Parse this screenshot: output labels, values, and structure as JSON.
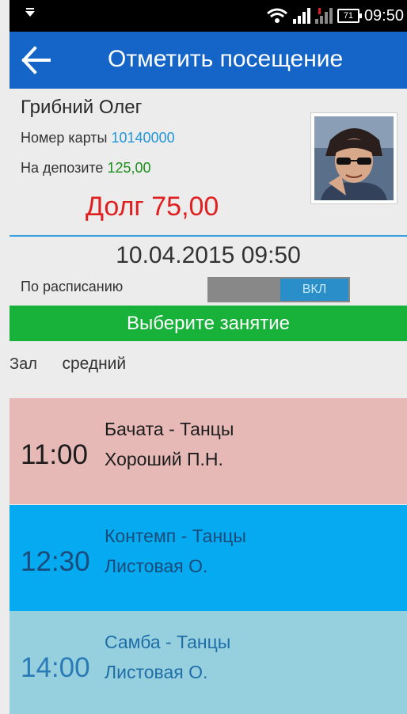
{
  "status_bar": {
    "battery": "71",
    "time": "09:50"
  },
  "app_bar": {
    "title": "Отметить посещение"
  },
  "client": {
    "name": "Грибний Олег",
    "card_label": "Номер карты",
    "card_number": "10140000",
    "deposit_label": "На депозите",
    "deposit_value": "125,00",
    "debt_text": "Долг 75,00"
  },
  "visit": {
    "datetime": "10.04.2015 09:50",
    "schedule_label": "По расписанию",
    "schedule_toggle": "ВКЛ",
    "choose_label": "Выберите занятие",
    "hall_label": "Зал",
    "hall_value": "средний"
  },
  "lessons": [
    {
      "time": "11:00",
      "title": "Бачата - Танцы",
      "teacher": "Хороший П.Н."
    },
    {
      "time": "12:30",
      "title": "Контемп - Танцы",
      "teacher": "Листовая О."
    },
    {
      "time": "14:00",
      "title": "Самба - Танцы",
      "teacher": "Листовая О."
    }
  ],
  "colors": {
    "app_bar": "#1565c8",
    "debt": "#e02020",
    "choose_bar": "#18b23a",
    "lesson_1": "#e6b9b7",
    "lesson_2": "#06aaf0",
    "lesson_3": "#96d0de"
  },
  "icons": [
    "notification-icon",
    "wifi-icon",
    "signal-icon",
    "battery-icon",
    "back-arrow-icon"
  ]
}
